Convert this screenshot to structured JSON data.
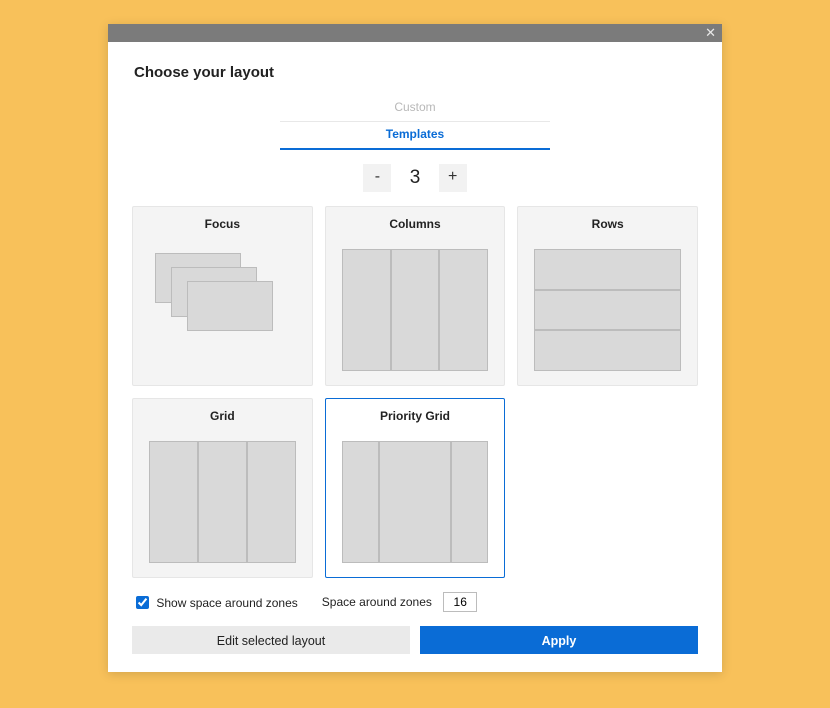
{
  "heading": "Choose your layout",
  "tabs": {
    "custom": "Custom",
    "templates": "Templates",
    "active": "templates"
  },
  "zone_count": 3,
  "templates": {
    "focus": {
      "label": "Focus"
    },
    "columns": {
      "label": "Columns"
    },
    "rows": {
      "label": "Rows"
    },
    "grid": {
      "label": "Grid"
    },
    "priority": {
      "label": "Priority Grid"
    }
  },
  "selected_template": "priority",
  "options": {
    "show_space": {
      "label": "Show space around zones",
      "checked": true
    },
    "space_around": {
      "label": "Space around zones",
      "value": 16
    }
  },
  "buttons": {
    "edit": "Edit selected layout",
    "apply": "Apply"
  }
}
